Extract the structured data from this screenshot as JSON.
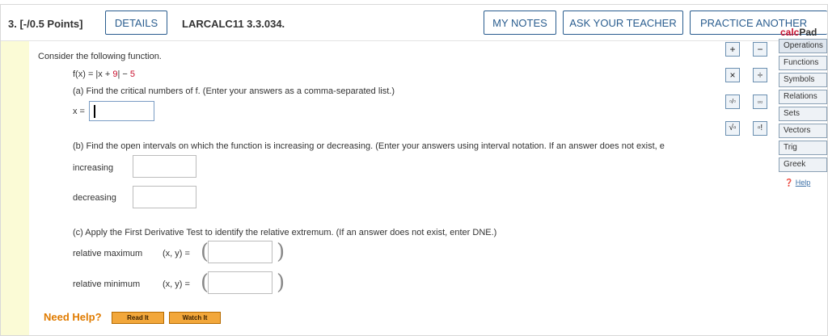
{
  "header": {
    "question_number": "3. [-/0.5 Points]",
    "details_label": "DETAILS",
    "question_ref": "LARCALC11 3.3.034.",
    "my_notes_label": "MY NOTES",
    "ask_teacher_label": "ASK YOUR TEACHER",
    "practice_label": "PRACTICE ANOTHER"
  },
  "problem": {
    "intro": "Consider the following function.",
    "function_lhs": "f(x) = |x + ",
    "function_red": "9",
    "function_mid": "| − ",
    "function_red2": "5",
    "part_a": "(a) Find the critical numbers of f. (Enter your answers as a comma-separated list.)",
    "x_label": "x =",
    "part_b": "(b) Find the open intervals on which the function is increasing or decreasing. (Enter your answers using interval notation. If an answer does not exist, e",
    "increasing_label": "increasing",
    "decreasing_label": "decreasing",
    "part_c": "(c) Apply the First Derivative Test to identify the relative extremum. (If an answer does not exist, enter DNE.)",
    "rel_max_label": "relative maximum",
    "rel_min_label": "relative minimum",
    "xy_label": "(x, y) ="
  },
  "help": {
    "need_help": "Need Help?",
    "read_it": "Read It",
    "watch_it": "Watch It"
  },
  "calcpad": {
    "title_prefix": "calc",
    "title_suffix": "Pad",
    "keys": [
      "+",
      "−",
      "×",
      "÷",
      "▫/▫",
      "▫▫",
      "√▫",
      "▫!"
    ],
    "tabs": [
      "Operations",
      "Functions",
      "Symbols",
      "Relations",
      "Sets",
      "Vectors",
      "Trig",
      "Greek"
    ],
    "help_label": "Help"
  }
}
